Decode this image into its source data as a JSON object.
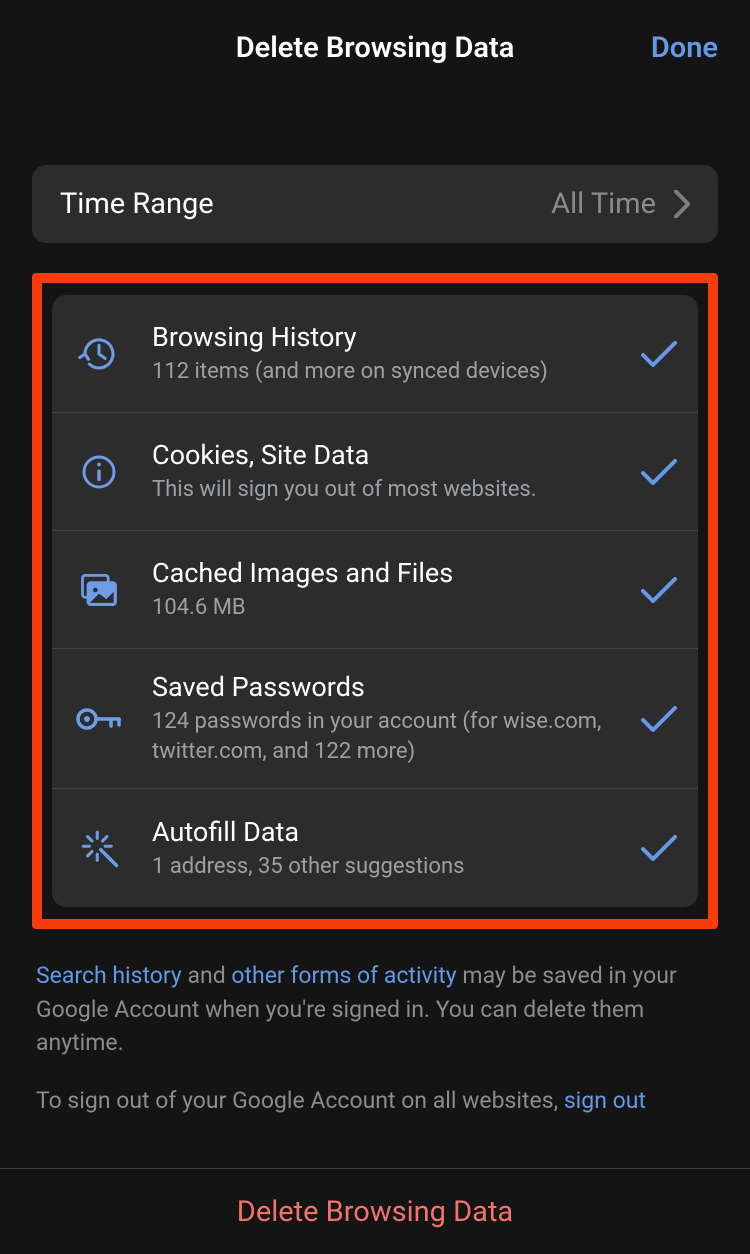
{
  "header": {
    "title": "Delete Browsing Data",
    "done": "Done"
  },
  "timeRange": {
    "label": "Time Range",
    "value": "All Time"
  },
  "items": [
    {
      "title": "Browsing History",
      "subtitle": "112 items (and more on synced devices)"
    },
    {
      "title": "Cookies, Site Data",
      "subtitle": "This will sign you out of most websites."
    },
    {
      "title": "Cached Images and Files",
      "subtitle": "104.6 MB"
    },
    {
      "title": "Saved Passwords",
      "subtitle": "124 passwords in your account (for wise.com, twitter.com, and 122 more)"
    },
    {
      "title": "Autofill Data",
      "subtitle": "1 address, 35 other suggestions"
    }
  ],
  "footer": {
    "link1": "Search history",
    "text1": " and ",
    "link2": "other forms of activity",
    "text2": " may be saved in your Google Account when you're signed in. You can delete them anytime."
  },
  "signout": {
    "text": "To sign out of your Google Account on all websites, ",
    "link": "sign out"
  },
  "bottom": {
    "delete": "Delete Browsing Data"
  },
  "colors": {
    "accent": "#6499e8",
    "highlight": "#f53c0a",
    "danger": "#f27369"
  }
}
